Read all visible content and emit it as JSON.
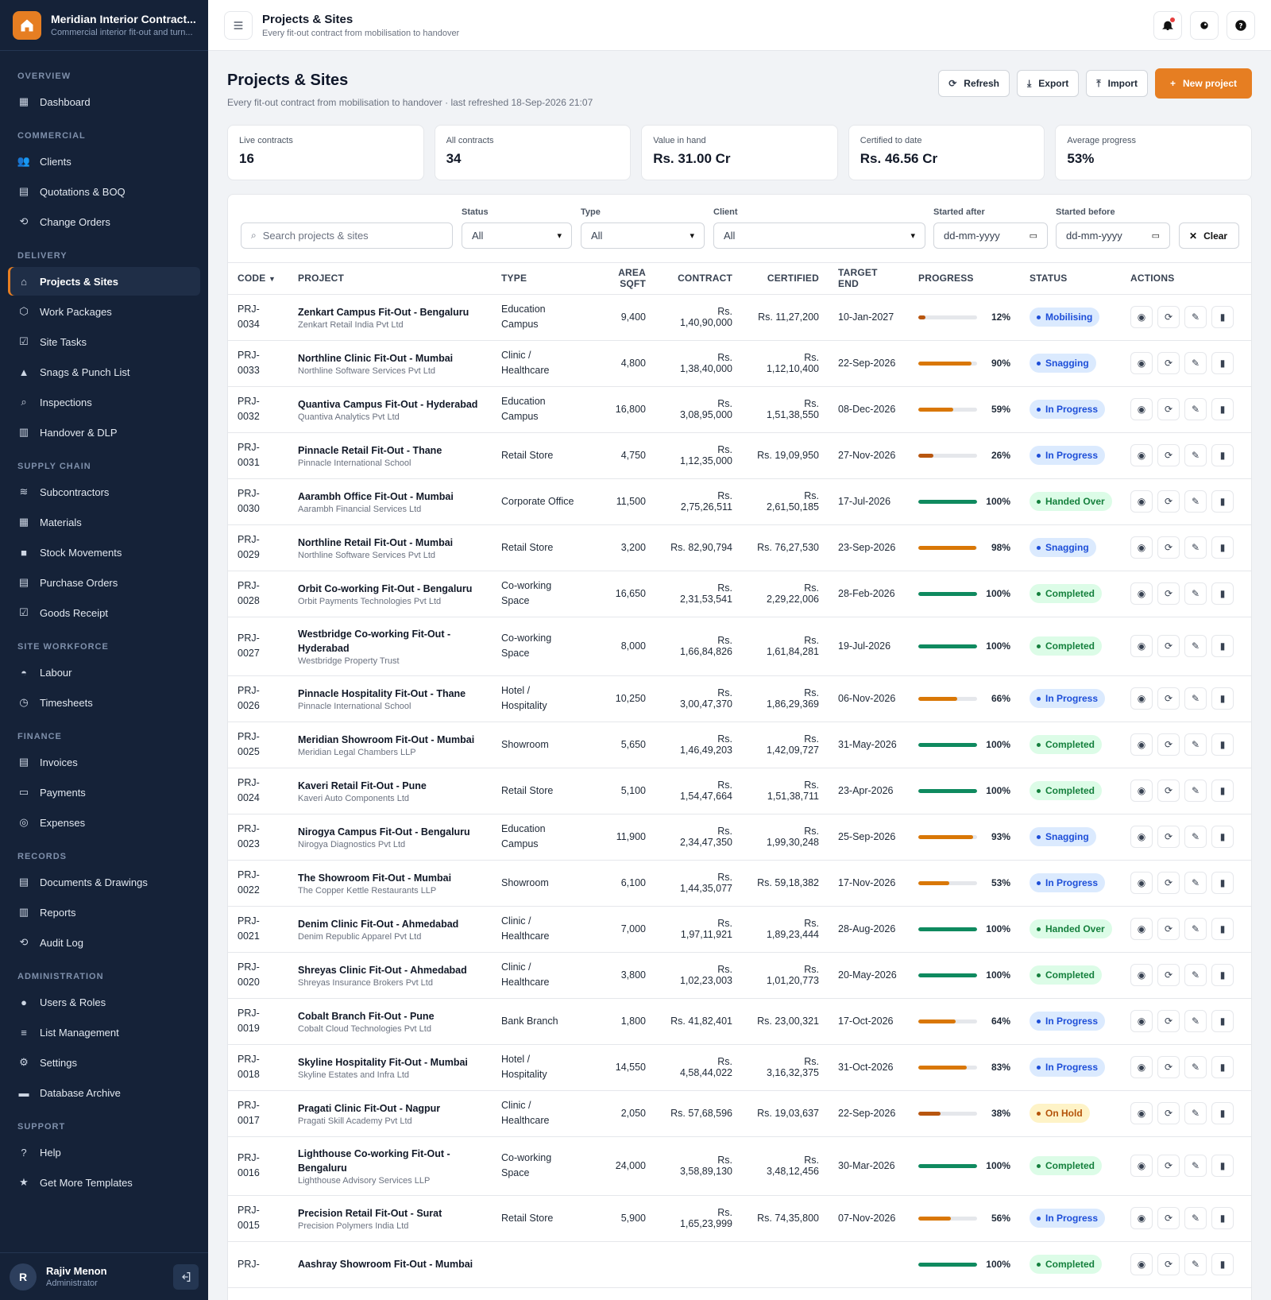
{
  "app": {
    "name": "Meridian Interior Contract...",
    "tagline": "Commercial interior fit-out and turn..."
  },
  "nav": [
    {
      "group": "OVERVIEW",
      "items": [
        {
          "label": "Dashboard",
          "icon": "dashboard-icon"
        }
      ]
    },
    {
      "group": "COMMERCIAL",
      "items": [
        {
          "label": "Clients",
          "icon": "users-icon"
        },
        {
          "label": "Quotations & BOQ",
          "icon": "document-icon"
        },
        {
          "label": "Change Orders",
          "icon": "change-icon"
        }
      ]
    },
    {
      "group": "DELIVERY",
      "items": [
        {
          "label": "Projects & Sites",
          "icon": "home-icon",
          "active": true
        },
        {
          "label": "Work Packages",
          "icon": "package-icon"
        },
        {
          "label": "Site Tasks",
          "icon": "checklist-icon"
        },
        {
          "label": "Snags & Punch List",
          "icon": "warning-icon"
        },
        {
          "label": "Inspections",
          "icon": "search-icon"
        },
        {
          "label": "Handover & DLP",
          "icon": "building-icon"
        }
      ]
    },
    {
      "group": "SUPPLY CHAIN",
      "items": [
        {
          "label": "Subcontractors",
          "icon": "layers-icon"
        },
        {
          "label": "Materials",
          "icon": "grid-icon"
        },
        {
          "label": "Stock Movements",
          "icon": "box-icon"
        },
        {
          "label": "Purchase Orders",
          "icon": "receipt-icon"
        },
        {
          "label": "Goods Receipt",
          "icon": "check-square-icon"
        }
      ]
    },
    {
      "group": "SITE WORKFORCE",
      "items": [
        {
          "label": "Labour",
          "icon": "hardhat-icon"
        },
        {
          "label": "Timesheets",
          "icon": "clock-icon"
        }
      ]
    },
    {
      "group": "FINANCE",
      "items": [
        {
          "label": "Invoices",
          "icon": "invoice-icon"
        },
        {
          "label": "Payments",
          "icon": "card-icon"
        },
        {
          "label": "Expenses",
          "icon": "coin-icon"
        }
      ]
    },
    {
      "group": "RECORDS",
      "items": [
        {
          "label": "Documents & Drawings",
          "icon": "file-icon"
        },
        {
          "label": "Reports",
          "icon": "chart-icon"
        },
        {
          "label": "Audit Log",
          "icon": "history-icon"
        }
      ]
    },
    {
      "group": "ADMINISTRATION",
      "items": [
        {
          "label": "Users & Roles",
          "icon": "user-icon"
        },
        {
          "label": "List Management",
          "icon": "list-icon"
        },
        {
          "label": "Settings",
          "icon": "gear-icon"
        },
        {
          "label": "Database Archive",
          "icon": "archive-icon"
        }
      ]
    },
    {
      "group": "SUPPORT",
      "items": [
        {
          "label": "Help",
          "icon": "help-icon"
        },
        {
          "label": "Get More Templates",
          "icon": "star-icon"
        }
      ]
    }
  ],
  "user": {
    "initial": "R",
    "name": "Rajiv Menon",
    "role": "Administrator"
  },
  "topbar": {
    "title": "Projects & Sites",
    "subtitle": "Every fit-out contract from mobilisation to handover"
  },
  "page": {
    "title": "Projects & Sites",
    "subtitle": "Every fit-out contract from mobilisation to handover · last refreshed 18-Sep-2026 21:07",
    "buttons": {
      "refresh": "Refresh",
      "export": "Export",
      "import": "Import",
      "new": "New project"
    }
  },
  "stats": [
    {
      "label": "Live contracts",
      "value": "16"
    },
    {
      "label": "All contracts",
      "value": "34"
    },
    {
      "label": "Value in hand",
      "value": "Rs. 31.00 Cr"
    },
    {
      "label": "Certified to date",
      "value": "Rs. 46.56 Cr"
    },
    {
      "label": "Average progress",
      "value": "53%"
    }
  ],
  "filters": {
    "search_placeholder": "Search projects & sites",
    "status_label": "Status",
    "status_value": "All",
    "type_label": "Type",
    "type_value": "All",
    "client_label": "Client",
    "client_value": "All",
    "after_label": "Started after",
    "after_value": "dd-mm-yyyy",
    "before_label": "Started before",
    "before_value": "dd-mm-yyyy",
    "clear": "Clear"
  },
  "columns": {
    "code": "CODE",
    "project": "PROJECT",
    "type": "TYPE",
    "area": "AREA SQFT",
    "contract": "CONTRACT",
    "certified": "CERTIFIED",
    "target": "TARGET END",
    "progress": "PROGRESS",
    "status": "STATUS",
    "actions": "ACTIONS"
  },
  "status_colors": {
    "Mobilising": {
      "bg": "#dbeafe",
      "fg": "#1d4ed8"
    },
    "Snagging": {
      "bg": "#dbeafe",
      "fg": "#1d4ed8"
    },
    "In Progress": {
      "bg": "#dbeafe",
      "fg": "#1d4ed8"
    },
    "Handed Over": {
      "bg": "#dcfce7",
      "fg": "#15803d"
    },
    "Completed": {
      "bg": "#dcfce7",
      "fg": "#15803d"
    },
    "On Hold": {
      "bg": "#fef3c7",
      "fg": "#b45309"
    }
  },
  "rows": [
    {
      "code": [
        "PRJ-",
        "0034"
      ],
      "name": "Zenkart Campus Fit-Out - Bengaluru",
      "client": "Zenkart Retail India Pvt Ltd",
      "type": [
        "Education",
        "Campus"
      ],
      "area": "9,400",
      "contract": "Rs. 1,40,90,000",
      "certified": "Rs. 11,27,200",
      "target": "10-Jan-2027",
      "progress": 12,
      "status": "Mobilising"
    },
    {
      "code": [
        "PRJ-",
        "0033"
      ],
      "name": "Northline Clinic Fit-Out - Mumbai",
      "client": "Northline Software Services Pvt Ltd",
      "type": [
        "Clinic /",
        "Healthcare"
      ],
      "area": "4,800",
      "contract": "Rs. 1,38,40,000",
      "certified": "Rs. 1,12,10,400",
      "target": "22-Sep-2026",
      "progress": 90,
      "status": "Snagging"
    },
    {
      "code": [
        "PRJ-",
        "0032"
      ],
      "name": "Quantiva Campus Fit-Out - Hyderabad",
      "client": "Quantiva Analytics Pvt Ltd",
      "type": [
        "Education",
        "Campus"
      ],
      "area": "16,800",
      "contract": "Rs. 3,08,95,000",
      "certified": "Rs. 1,51,38,550",
      "target": "08-Dec-2026",
      "progress": 59,
      "status": "In Progress"
    },
    {
      "code": [
        "PRJ-",
        "0031"
      ],
      "name": "Pinnacle Retail Fit-Out - Thane",
      "client": "Pinnacle International School",
      "type": [
        "Retail Store"
      ],
      "area": "4,750",
      "contract": "Rs. 1,12,35,000",
      "certified": "Rs. 19,09,950",
      "target": "27-Nov-2026",
      "progress": 26,
      "status": "In Progress"
    },
    {
      "code": [
        "PRJ-",
        "0030"
      ],
      "name": "Aarambh Office Fit-Out - Mumbai",
      "client": "Aarambh Financial Services Ltd",
      "type": [
        "Corporate Office"
      ],
      "area": "11,500",
      "contract": "Rs. 2,75,26,511",
      "certified": "Rs. 2,61,50,185",
      "target": "17-Jul-2026",
      "progress": 100,
      "status": "Handed Over"
    },
    {
      "code": [
        "PRJ-",
        "0029"
      ],
      "name": "Northline Retail Fit-Out - Mumbai",
      "client": "Northline Software Services Pvt Ltd",
      "type": [
        "Retail Store"
      ],
      "area": "3,200",
      "contract": "Rs. 82,90,794",
      "certified": "Rs. 76,27,530",
      "target": "23-Sep-2026",
      "progress": 98,
      "status": "Snagging"
    },
    {
      "code": [
        "PRJ-",
        "0028"
      ],
      "name": "Orbit Co-working Fit-Out - Bengaluru",
      "client": "Orbit Payments Technologies Pvt Ltd",
      "type": [
        "Co-working",
        "Space"
      ],
      "area": "16,650",
      "contract": "Rs. 2,31,53,541",
      "certified": "Rs. 2,29,22,006",
      "target": "28-Feb-2026",
      "progress": 100,
      "status": "Completed"
    },
    {
      "code": [
        "PRJ-",
        "0027"
      ],
      "name": "Westbridge Co-working Fit-Out - Hyderabad",
      "client": "Westbridge Property Trust",
      "type": [
        "Co-working",
        "Space"
      ],
      "area": "8,000",
      "contract": "Rs. 1,66,84,826",
      "certified": "Rs. 1,61,84,281",
      "target": "19-Jul-2026",
      "progress": 100,
      "status": "Completed"
    },
    {
      "code": [
        "PRJ-",
        "0026"
      ],
      "name": "Pinnacle Hospitality Fit-Out - Thane",
      "client": "Pinnacle International School",
      "type": [
        "Hotel /",
        "Hospitality"
      ],
      "area": "10,250",
      "contract": "Rs. 3,00,47,370",
      "certified": "Rs. 1,86,29,369",
      "target": "06-Nov-2026",
      "progress": 66,
      "status": "In Progress"
    },
    {
      "code": [
        "PRJ-",
        "0025"
      ],
      "name": "Meridian Showroom Fit-Out - Mumbai",
      "client": "Meridian Legal Chambers LLP",
      "type": [
        "Showroom"
      ],
      "area": "5,650",
      "contract": "Rs. 1,46,49,203",
      "certified": "Rs. 1,42,09,727",
      "target": "31-May-2026",
      "progress": 100,
      "status": "Completed"
    },
    {
      "code": [
        "PRJ-",
        "0024"
      ],
      "name": "Kaveri Retail Fit-Out - Pune",
      "client": "Kaveri Auto Components Ltd",
      "type": [
        "Retail Store"
      ],
      "area": "5,100",
      "contract": "Rs. 1,54,47,664",
      "certified": "Rs. 1,51,38,711",
      "target": "23-Apr-2026",
      "progress": 100,
      "status": "Completed"
    },
    {
      "code": [
        "PRJ-",
        "0023"
      ],
      "name": "Nirogya Campus Fit-Out - Bengaluru",
      "client": "Nirogya Diagnostics Pvt Ltd",
      "type": [
        "Education",
        "Campus"
      ],
      "area": "11,900",
      "contract": "Rs. 2,34,47,350",
      "certified": "Rs. 1,99,30,248",
      "target": "25-Sep-2026",
      "progress": 93,
      "status": "Snagging"
    },
    {
      "code": [
        "PRJ-",
        "0022"
      ],
      "name": "The Showroom Fit-Out - Mumbai",
      "client": "The Copper Kettle Restaurants LLP",
      "type": [
        "Showroom"
      ],
      "area": "6,100",
      "contract": "Rs. 1,44,35,077",
      "certified": "Rs. 59,18,382",
      "target": "17-Nov-2026",
      "progress": 53,
      "status": "In Progress"
    },
    {
      "code": [
        "PRJ-",
        "0021"
      ],
      "name": "Denim Clinic Fit-Out - Ahmedabad",
      "client": "Denim Republic Apparel Pvt Ltd",
      "type": [
        "Clinic /",
        "Healthcare"
      ],
      "area": "7,000",
      "contract": "Rs. 1,97,11,921",
      "certified": "Rs. 1,89,23,444",
      "target": "28-Aug-2026",
      "progress": 100,
      "status": "Handed Over"
    },
    {
      "code": [
        "PRJ-",
        "0020"
      ],
      "name": "Shreyas Clinic Fit-Out - Ahmedabad",
      "client": "Shreyas Insurance Brokers Pvt Ltd",
      "type": [
        "Clinic /",
        "Healthcare"
      ],
      "area": "3,800",
      "contract": "Rs. 1,02,23,003",
      "certified": "Rs. 1,01,20,773",
      "target": "20-May-2026",
      "progress": 100,
      "status": "Completed"
    },
    {
      "code": [
        "PRJ-",
        "0019"
      ],
      "name": "Cobalt Branch Fit-Out - Pune",
      "client": "Cobalt Cloud Technologies Pvt Ltd",
      "type": [
        "Bank Branch"
      ],
      "area": "1,800",
      "contract": "Rs. 41,82,401",
      "certified": "Rs. 23,00,321",
      "target": "17-Oct-2026",
      "progress": 64,
      "status": "In Progress"
    },
    {
      "code": [
        "PRJ-",
        "0018"
      ],
      "name": "Skyline Hospitality Fit-Out - Mumbai",
      "client": "Skyline Estates and Infra Ltd",
      "type": [
        "Hotel /",
        "Hospitality"
      ],
      "area": "14,550",
      "contract": "Rs. 4,58,44,022",
      "certified": "Rs. 3,16,32,375",
      "target": "31-Oct-2026",
      "progress": 83,
      "status": "In Progress"
    },
    {
      "code": [
        "PRJ-",
        "0017"
      ],
      "name": "Pragati Clinic Fit-Out - Nagpur",
      "client": "Pragati Skill Academy Pvt Ltd",
      "type": [
        "Clinic /",
        "Healthcare"
      ],
      "area": "2,050",
      "contract": "Rs. 57,68,596",
      "certified": "Rs. 19,03,637",
      "target": "22-Sep-2026",
      "progress": 38,
      "status": "On Hold"
    },
    {
      "code": [
        "PRJ-",
        "0016"
      ],
      "name": "Lighthouse Co-working Fit-Out - Bengaluru",
      "client": "Lighthouse Advisory Services LLP",
      "type": [
        "Co-working",
        "Space"
      ],
      "area": "24,000",
      "contract": "Rs. 3,58,89,130",
      "certified": "Rs. 3,48,12,456",
      "target": "30-Mar-2026",
      "progress": 100,
      "status": "Completed"
    },
    {
      "code": [
        "PRJ-",
        "0015"
      ],
      "name": "Precision Retail Fit-Out - Surat",
      "client": "Precision Polymers India Ltd",
      "type": [
        "Retail Store"
      ],
      "area": "5,900",
      "contract": "Rs. 1,65,23,999",
      "certified": "Rs. 74,35,800",
      "target": "07-Nov-2026",
      "progress": 56,
      "status": "In Progress"
    },
    {
      "code": [
        "PRJ-",
        ""
      ],
      "name": "Aashray Showroom Fit-Out - Mumbai",
      "client": "",
      "type": [
        ""
      ],
      "area": "",
      "contract": "",
      "certified": "",
      "target": "",
      "progress": 100,
      "status": "Completed"
    }
  ]
}
